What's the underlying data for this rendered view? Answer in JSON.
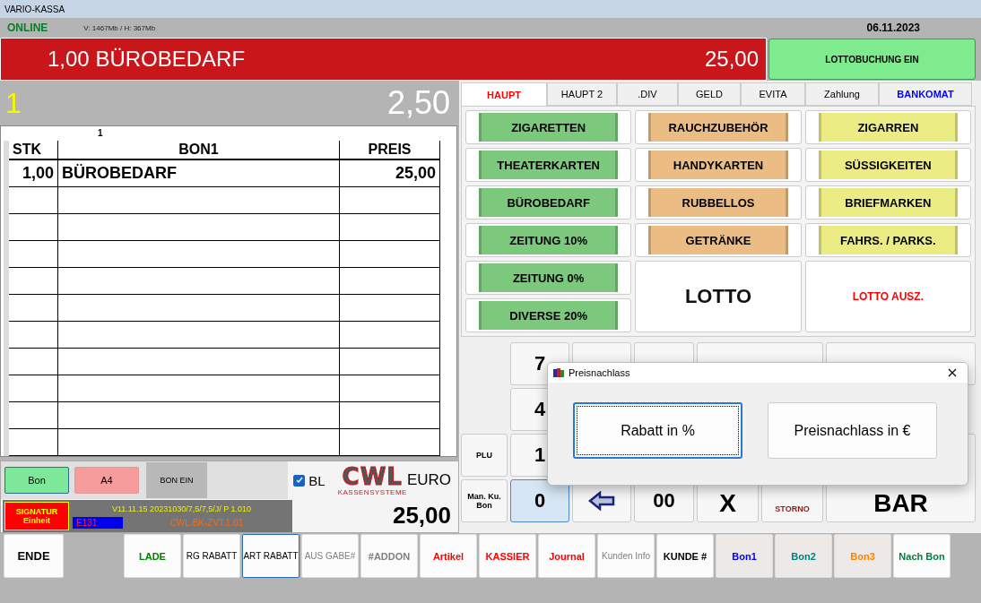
{
  "window": {
    "title": "VARIO-KASSA"
  },
  "status": {
    "connection": "ONLINE",
    "memory": "V: 1467Mb / H: 367Mb",
    "date": "06.11.2023"
  },
  "display": {
    "item": "1,00 BÜROBEDARF",
    "amount": "25,00",
    "lotto_button": "LOTTOBUCHUNG EIN"
  },
  "counter": {
    "quantity": "1",
    "price": "2,50"
  },
  "receipt": {
    "label": "1",
    "columns": [
      "STK",
      "BON1",
      "PREIS"
    ],
    "rows": [
      [
        "1,00",
        "BÜROBEDARF",
        "25,00"
      ]
    ]
  },
  "print_options": [
    {
      "label": "Bon",
      "color": "#7ee89a"
    },
    {
      "label": "A4",
      "color": "#f79c9c"
    }
  ],
  "bon_ein": "BON EIN",
  "bl_checkbox": {
    "label": "BL",
    "checked": true
  },
  "logo": {
    "name": "CWL",
    "tagline": "KASSENSYSTEME"
  },
  "currency": "EURO",
  "total": "25,00",
  "signature": {
    "label": "SIGNATUR Einheit",
    "version": "V11.11.15 20231030/7,5/7,5/J/ P 1.010",
    "error": "E131",
    "terminal": "CWL.BK-ZVT.1.01"
  },
  "tabs": [
    {
      "label": "HAUPT",
      "selected": true,
      "kind": "plain"
    },
    {
      "label": "HAUPT 2",
      "selected": false,
      "kind": "plain"
    },
    {
      "label": ".DIV",
      "selected": false,
      "kind": "plain"
    },
    {
      "label": "GELD",
      "selected": false,
      "kind": "plain"
    },
    {
      "label": "EVITA",
      "selected": false,
      "kind": "plain"
    },
    {
      "label": "Zahlung",
      "selected": false,
      "kind": "plain"
    },
    {
      "label": "BANKOMAT",
      "selected": false,
      "kind": "payment"
    }
  ],
  "categories": [
    {
      "label": "ZIGARETTEN",
      "kind": "group",
      "color": "#7cc97e"
    },
    {
      "label": "RAUCHZUBEHÖR",
      "kind": "group",
      "color": "#ebbd85"
    },
    {
      "label": "ZIGARREN",
      "kind": "group",
      "color": "#ecec84"
    },
    {
      "label": "THEATERKARTEN",
      "kind": "group",
      "color": "#7cc97e"
    },
    {
      "label": "HANDYKARTEN",
      "kind": "group",
      "color": "#ebbd85"
    },
    {
      "label": "SÜSSIGKEITEN",
      "kind": "group",
      "color": "#ecec84"
    },
    {
      "label": "BÜROBEDARF",
      "kind": "group",
      "color": "#7cc97e"
    },
    {
      "label": "RUBBELLOS",
      "kind": "group",
      "color": "#ebbd85"
    },
    {
      "label": "BRIEFMARKEN",
      "kind": "group",
      "color": "#ecec84"
    },
    {
      "label": "ZEITUNG 10%",
      "kind": "group",
      "color": "#7cc97e"
    },
    {
      "label": "GETRÄNKE",
      "kind": "group",
      "color": "#ebbd85"
    },
    {
      "label": "FAHRS. / PARKS.",
      "kind": "group",
      "color": "#ecec84"
    },
    {
      "label": "ZEITUNG  0%",
      "kind": "group",
      "color": "#7cc97e"
    },
    {
      "label": "LOTTO",
      "kind": "big",
      "color": "#111111"
    },
    {
      "label": "LOTTO AUSZ.",
      "kind": "big-small",
      "color": "#ff0000"
    },
    {
      "label": "DIVERSE 20%",
      "kind": "group",
      "color": "#7cc97e"
    }
  ],
  "keypad": [
    {
      "label": "7",
      "kind": "digit",
      "selected": false
    },
    {
      "kind": "digit",
      "selected": false
    },
    {
      "kind": "digit",
      "selected": false
    },
    {
      "kind": "wide",
      "selected": false
    },
    {
      "kind": "digit",
      "selected": false
    },
    {
      "label": "4",
      "kind": "digit",
      "selected": false
    },
    {
      "label": "PLU",
      "kind": "small",
      "selected": false
    },
    {
      "label": "1",
      "kind": "digit",
      "selected": false
    },
    {
      "label": "Man. Ku. Bon",
      "kind": "small",
      "selected": false
    },
    {
      "label": "0",
      "kind": "digit",
      "selected": true
    },
    {
      "kind": "arrow",
      "selected": false
    },
    {
      "label": "00",
      "kind": "digit",
      "selected": false
    },
    {
      "label": "X",
      "kind": "tall",
      "selected": false
    },
    {
      "label": "STORNO",
      "kind": "storno",
      "selected": false
    },
    {
      "label": "BAR",
      "kind": "tall",
      "selected": false
    }
  ],
  "dialog": {
    "title": "Preisnachlass",
    "buttons": [
      {
        "label": "Rabatt in %",
        "selected": true
      },
      {
        "label": "Preisnachlass in €",
        "selected": false
      }
    ]
  },
  "function_keys": [
    {
      "label": "ENDE",
      "kind": "plain",
      "color": "#000000"
    },
    {
      "kind": "spacer"
    },
    {
      "label": "LADE",
      "kind": "plain",
      "color": "#008000"
    },
    {
      "label": "RG RABATT",
      "kind": "plain",
      "color": "#000000"
    },
    {
      "label": "ART RABATT",
      "kind": "focused",
      "color": "#000000"
    },
    {
      "label": "AUS GABE#",
      "kind": "plain",
      "color": "#808080"
    },
    {
      "label": "#ADDON",
      "kind": "plain",
      "color": "#808080"
    },
    {
      "label": "Artikel",
      "kind": "plain",
      "color": "#ff0000"
    },
    {
      "label": "KASSIER",
      "kind": "plain",
      "color": "#ff0000"
    },
    {
      "label": "Journal",
      "kind": "plain",
      "color": "#ff0000"
    },
    {
      "label": "Kunden Info",
      "kind": "plain",
      "color": "#808080"
    },
    {
      "label": "KUNDE #",
      "kind": "plain",
      "color": "#000000"
    },
    {
      "label": "Bon1",
      "kind": "shaded",
      "color": "#0000ff"
    },
    {
      "label": "Bon2",
      "kind": "shaded",
      "color": "#008080"
    },
    {
      "label": "Bon3",
      "kind": "shaded",
      "color": "#ff8000"
    },
    {
      "label": "Nach Bon",
      "kind": "plain",
      "color": "#008040"
    }
  ]
}
